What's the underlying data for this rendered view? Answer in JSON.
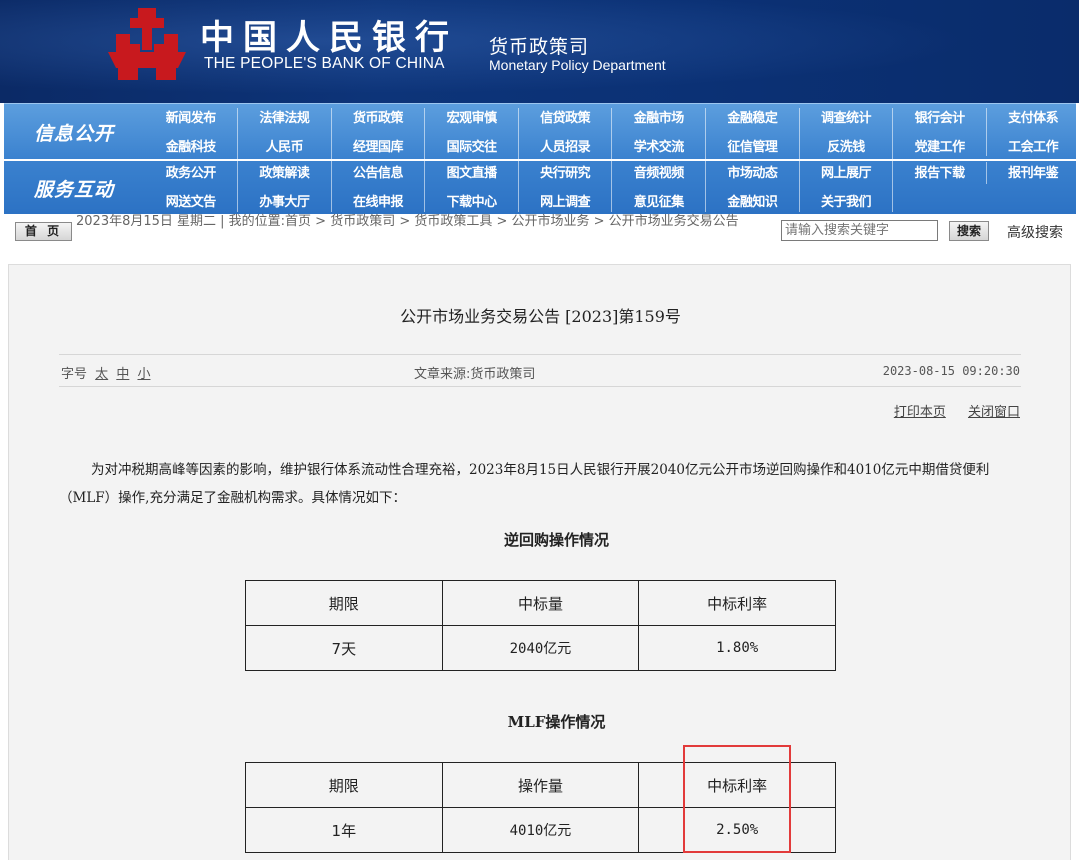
{
  "header": {
    "bank_name_cn": "中国人民银行",
    "bank_name_en": "THE PEOPLE'S BANK OF CHINA",
    "dept_cn": "货币政策司",
    "dept_en": "Monetary Policy Department",
    "logo_icon": "pboc-emblem-icon",
    "colors": {
      "header_bg": "#0d3479",
      "emblem_red": "#c8191e",
      "nav_blue": "#3b82cf"
    }
  },
  "nav": {
    "section_info": "信息公开",
    "section_service": "服务互动",
    "rows": [
      [
        "新闻发布",
        "法律法规",
        "货币政策",
        "宏观审慎",
        "信贷政策",
        "金融市场",
        "金融稳定",
        "调查统计",
        "银行会计",
        "支付体系"
      ],
      [
        "金融科技",
        "人民币",
        "经理国库",
        "国际交往",
        "人员招录",
        "学术交流",
        "征信管理",
        "反洗钱",
        "党建工作",
        "工会工作"
      ],
      [
        "政务公开",
        "政策解读",
        "公告信息",
        "图文直播",
        "央行研究",
        "音频视频",
        "市场动态",
        "网上展厅",
        "报告下载",
        "报刊年鉴"
      ],
      [
        "网送文告",
        "办事大厅",
        "在线申报",
        "下载中心",
        "网上调查",
        "意见征集",
        "金融知识",
        "关于我们"
      ]
    ]
  },
  "breadcrumb": {
    "home_button": "首 页",
    "date_line": "2023年8月15日 星期二 | 我的位置:首页 > 货币政策司 > 货币政策工具 > 公开市场业务 > 公开市场业务交易公告",
    "search_placeholder": "请输入搜索关键字",
    "search_button": "搜索",
    "advanced_search": "高级搜索"
  },
  "article": {
    "title": "公开市场业务交易公告 [2023]第159号",
    "font_label": "字号",
    "font_sizes": [
      "太",
      "中",
      "小"
    ],
    "source": "文章来源:货币政策司",
    "datetime": "2023-08-15 09:20:30",
    "print": "打印本页",
    "close": "关闭窗口",
    "paragraph": "为对冲税期高峰等因素的影响，维护银行体系流动性合理充裕，2023年8月15日人民银行开展2040亿元公开市场逆回购操作和4010亿元中期借贷便利（MLF）操作,充分满足了金融机构需求。具体情况如下：",
    "reverse_repo": {
      "title": "逆回购操作情况",
      "headers": [
        "期限",
        "中标量",
        "中标利率"
      ],
      "rows": [
        [
          "7天",
          "2040亿元",
          "1.80%"
        ]
      ]
    },
    "mlf": {
      "title": "MLF操作情况",
      "headers": [
        "期限",
        "操作量",
        "中标利率"
      ],
      "rows": [
        [
          "1年",
          "4010亿元",
          "2.50%"
        ]
      ]
    },
    "highlight_color": "#e23a3a"
  }
}
